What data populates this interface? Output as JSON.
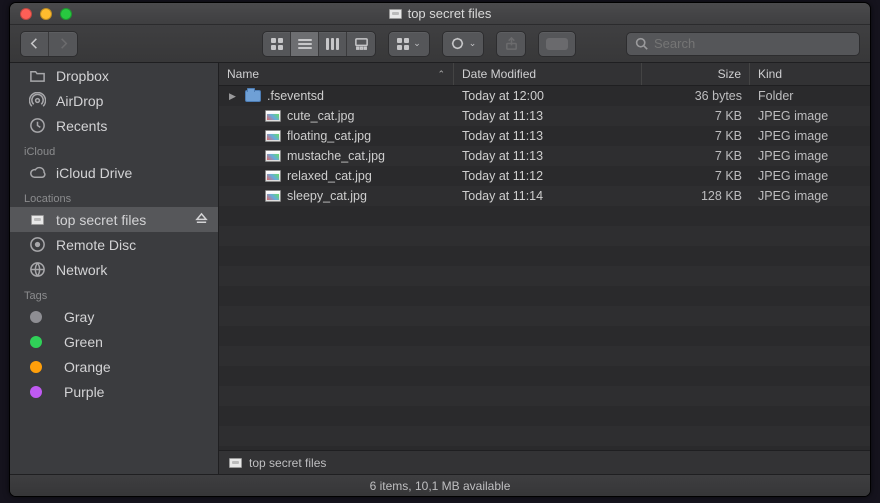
{
  "window": {
    "title": "top secret files"
  },
  "search": {
    "placeholder": "Search"
  },
  "sidebar": {
    "favorites": [
      {
        "label": "Dropbox",
        "icon": "folder"
      },
      {
        "label": "AirDrop",
        "icon": "airdrop"
      },
      {
        "label": "Recents",
        "icon": "clock"
      }
    ],
    "sections": {
      "icloud": "iCloud",
      "locations": "Locations",
      "tags": "Tags"
    },
    "icloud": [
      {
        "label": "iCloud Drive",
        "icon": "cloud"
      }
    ],
    "locations": [
      {
        "label": "top secret files",
        "icon": "disk",
        "selected": true,
        "eject": true
      },
      {
        "label": "Remote Disc",
        "icon": "remote"
      },
      {
        "label": "Network",
        "icon": "network"
      }
    ],
    "tags": [
      {
        "label": "Gray",
        "color": "#8e8e93"
      },
      {
        "label": "Green",
        "color": "#30d158"
      },
      {
        "label": "Orange",
        "color": "#ff9f0a"
      },
      {
        "label": "Purple",
        "color": "#bf5af2"
      }
    ]
  },
  "columns": {
    "name": "Name",
    "date": "Date Modified",
    "size": "Size",
    "kind": "Kind"
  },
  "files": [
    {
      "name": ".fseventsd",
      "date": "Today at 12:00",
      "size": "36 bytes",
      "kind": "Folder",
      "type": "folder",
      "expandable": true
    },
    {
      "name": "cute_cat.jpg",
      "date": "Today at 11:13",
      "size": "7 KB",
      "kind": "JPEG image",
      "type": "jpg"
    },
    {
      "name": "floating_cat.jpg",
      "date": "Today at 11:13",
      "size": "7 KB",
      "kind": "JPEG image",
      "type": "jpg"
    },
    {
      "name": "mustache_cat.jpg",
      "date": "Today at 11:13",
      "size": "7 KB",
      "kind": "JPEG image",
      "type": "jpg"
    },
    {
      "name": "relaxed_cat.jpg",
      "date": "Today at 11:12",
      "size": "7 KB",
      "kind": "JPEG image",
      "type": "jpg"
    },
    {
      "name": "sleepy_cat.jpg",
      "date": "Today at 11:14",
      "size": "128 KB",
      "kind": "JPEG image",
      "type": "jpg"
    }
  ],
  "pathbar": {
    "label": "top secret files"
  },
  "status": "6 items, 10,1 MB available"
}
